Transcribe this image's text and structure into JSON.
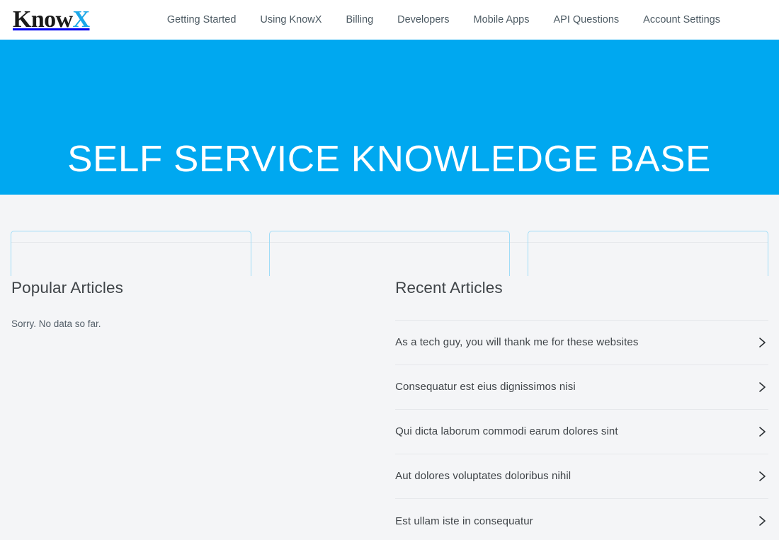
{
  "brand": {
    "name_first": "Know",
    "name_accent": "X",
    "accent_color": "#1aa7e8"
  },
  "nav": {
    "items": [
      {
        "label": "Getting Started",
        "name": "getting-started"
      },
      {
        "label": "Using KnowX",
        "name": "using-knowx"
      },
      {
        "label": "Billing",
        "name": "billing"
      },
      {
        "label": "Developers",
        "name": "developers"
      },
      {
        "label": "Mobile Apps",
        "name": "mobile-apps"
      },
      {
        "label": "API Questions",
        "name": "api-questions"
      },
      {
        "label": "Account Settings",
        "name": "account-settings"
      }
    ]
  },
  "hero": {
    "title": "SELF SERVICE KNOWLEDGE BASE",
    "background_color": "#00a8f0",
    "text_color": "#ffffff"
  },
  "cards": [
    {
      "label": ""
    },
    {
      "label": ""
    },
    {
      "label": ""
    }
  ],
  "popular": {
    "heading": "Popular Articles",
    "empty_message": "Sorry. No data so far."
  },
  "recent": {
    "heading": "Recent Articles",
    "chevron_icon": "chevron-right-icon",
    "items": [
      {
        "title": "As a tech guy, you will thank me for these websites"
      },
      {
        "title": "Consequatur est eius dignissimos nisi"
      },
      {
        "title": "Qui dicta laborum commodi earum dolores sint"
      },
      {
        "title": "Aut dolores voluptates doloribus nihil"
      },
      {
        "title": "Est ullam iste in consequatur"
      }
    ]
  },
  "theme": {
    "page_background": "#f4f5f7",
    "divider_color": "#e6e8eb",
    "text_color": "#3f4448"
  }
}
